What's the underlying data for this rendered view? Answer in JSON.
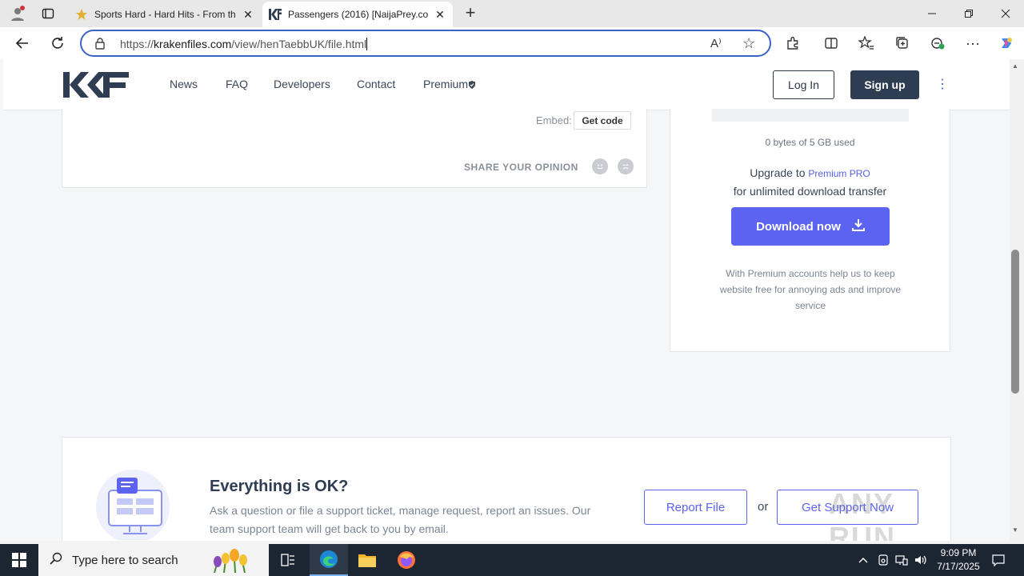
{
  "browser": {
    "tabs": [
      {
        "title": "Sports Hard - Hard Hits - From th",
        "active": false
      },
      {
        "title": "Passengers (2016) [NaijaPrey.com",
        "active": true
      }
    ],
    "address": {
      "scheme": "https://",
      "host": "krakenfiles.com",
      "path": "/view/henTaebbUK/file.html"
    },
    "read_aloud_label": "A⁾",
    "new_tab_symbol": "+"
  },
  "site": {
    "nav": [
      "News",
      "FAQ",
      "Developers",
      "Contact",
      "Premium"
    ],
    "login_label": "Log In",
    "signup_label": "Sign up",
    "embed_label": "Embed:",
    "get_code_label": "Get code",
    "share_label": "SHARE YOUR OPINION",
    "storage_text": "0 bytes of 5 GB used",
    "upgrade_prefix": "Upgrade to",
    "upgrade_link": "Premium PRO",
    "unlimited_text": "for unlimited download transfer",
    "download_label": "Download now",
    "premium_note": "With Premium accounts help us to keep website free for annoying ads and improve service",
    "support": {
      "title": "Everything is OK?",
      "description": "Ask a question or file a support ticket, manage request, report an issues. Our team support team will get back to you by email.",
      "report_label": "Report File",
      "or_label": "or",
      "support_label": "Get Support Now"
    },
    "watermark": "ANY RUN"
  },
  "taskbar": {
    "search_placeholder": "Type here to search",
    "time": "9:09 PM",
    "date": "7/17/2025"
  },
  "colors": {
    "accent": "#5b63f0",
    "dark": "#2f3d52",
    "address_border": "#3b63c6",
    "taskbar": "#1c2532"
  }
}
